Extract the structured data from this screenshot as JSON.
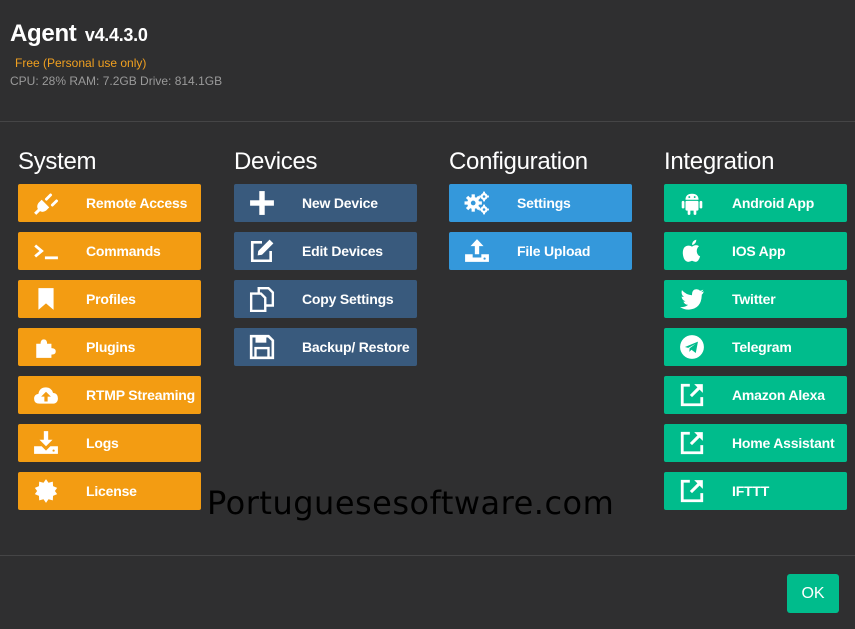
{
  "app": {
    "name": "Agent",
    "version": "v4.4.3.0",
    "license": "Free (Personal use only)",
    "stats": "CPU: 28% RAM: 7.2GB Drive: 814.1GB"
  },
  "sections": {
    "system": {
      "title": "System",
      "items": [
        {
          "label": "Remote Access",
          "icon": "plug-icon"
        },
        {
          "label": "Commands",
          "icon": "terminal-icon"
        },
        {
          "label": "Profiles",
          "icon": "bookmark-icon"
        },
        {
          "label": "Plugins",
          "icon": "puzzle-icon"
        },
        {
          "label": "RTMP Streaming",
          "icon": "cloud-upload-icon"
        },
        {
          "label": "Logs",
          "icon": "download-icon"
        },
        {
          "label": "License",
          "icon": "certificate-icon"
        }
      ]
    },
    "devices": {
      "title": "Devices",
      "items": [
        {
          "label": "New Device",
          "icon": "plus-icon"
        },
        {
          "label": "Edit Devices",
          "icon": "edit-icon"
        },
        {
          "label": "Copy Settings",
          "icon": "copy-icon"
        },
        {
          "label": "Backup/ Restore",
          "icon": "floppy-disk-icon"
        }
      ]
    },
    "configuration": {
      "title": "Configuration",
      "items": [
        {
          "label": "Settings",
          "icon": "gears-icon"
        },
        {
          "label": "File Upload",
          "icon": "upload-icon"
        }
      ]
    },
    "integration": {
      "title": "Integration",
      "items": [
        {
          "label": "Android App",
          "icon": "android-icon"
        },
        {
          "label": "IOS App",
          "icon": "apple-icon"
        },
        {
          "label": "Twitter",
          "icon": "twitter-icon"
        },
        {
          "label": "Telegram",
          "icon": "telegram-icon"
        },
        {
          "label": "Amazon Alexa",
          "icon": "external-link-icon"
        },
        {
          "label": "Home Assistant",
          "icon": "external-link-icon"
        },
        {
          "label": "IFTTT",
          "icon": "external-link-icon"
        }
      ]
    }
  },
  "watermark": "Portuguesesoftware.com",
  "footer": {
    "ok_label": "OK"
  },
  "colors": {
    "background": "#2f2f30",
    "system": "#f39c12",
    "devices": "#395a7d",
    "configuration": "#3498db",
    "integration": "#00bc8c",
    "license_text": "#f0a020"
  }
}
